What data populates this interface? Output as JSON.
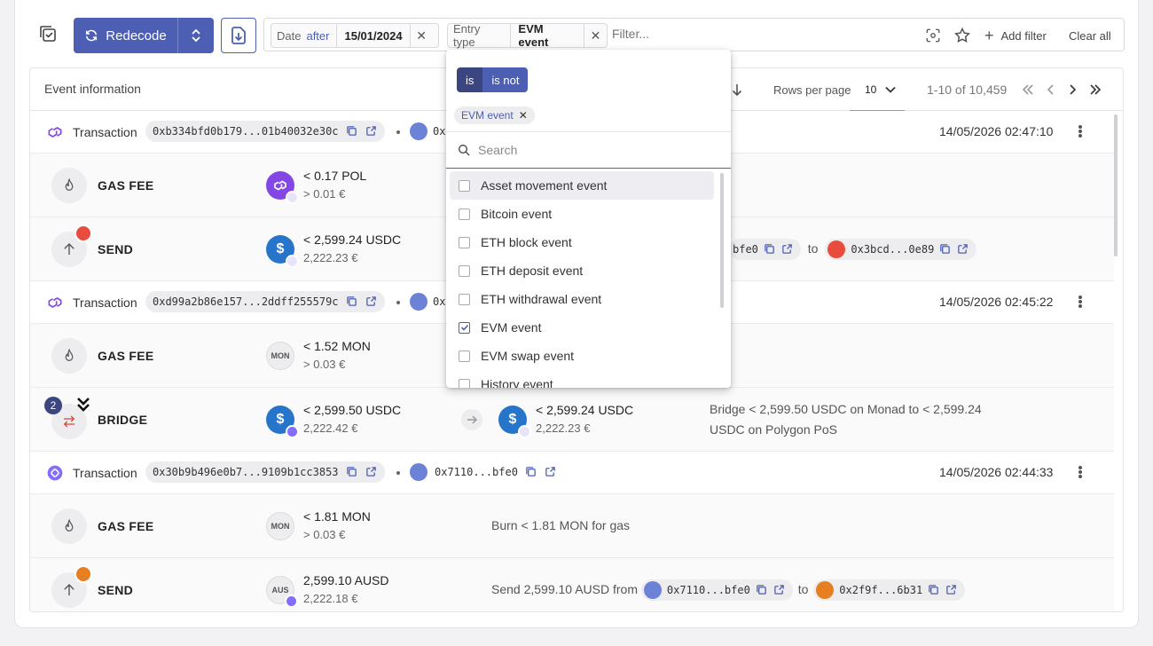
{
  "toolbar": {
    "redecode_label": "Redecode"
  },
  "filters": {
    "date_key": "Date",
    "date_op": "after",
    "date_value": "15/01/2024",
    "entry_key": "Entry type",
    "entry_value": "EVM event",
    "placeholder": "Filter...",
    "add_filter": "Add filter",
    "clear_all": "Clear all"
  },
  "table": {
    "header": "Event information",
    "rows_per_page_label": "Rows per page",
    "rows_per_page": "10",
    "range": "1-10 of 10,459"
  },
  "transactions": [
    {
      "label": "Transaction",
      "hash": "0xb334bfd0b179...01b40032e30c",
      "addr": "0x",
      "time": "14/05/2026 02:47:10"
    },
    {
      "label": "Transaction",
      "hash": "0xd99a2b86e157...2ddff255579c",
      "addr": "0x",
      "time": "14/05/2026 02:45:22"
    },
    {
      "label": "Transaction",
      "hash": "0x30b9b496e0b7...9109b1cc3853",
      "addr": "0x7110...bfe0",
      "time": "14/05/2026 02:44:33"
    }
  ],
  "events": [
    {
      "type": "GAS FEE",
      "amount": "< 0.17 POL",
      "fiat": "> 0.01 €"
    },
    {
      "type": "SEND",
      "amount": "< 2,599.24 USDC",
      "fiat": "2,222.23 €",
      "from_partial": "bfe0",
      "to_word": "to",
      "to_addr": "0x3bcd...0e89"
    },
    {
      "type": "GAS FEE",
      "amount": "< 1.52 MON",
      "fiat": "> 0.03 €",
      "coin": "MON"
    },
    {
      "type": "BRIDGE",
      "count": "2",
      "amount": "< 2,599.50 USDC",
      "fiat": "2,222.42 €",
      "amount2": "< 2,599.24 USDC",
      "fiat2": "2,222.23 €",
      "note_line1": "Bridge < 2,599.50 USDC on Monad to < 2,599.24",
      "note_line2": "USDC on Polygon PoS"
    },
    {
      "type": "GAS FEE",
      "amount": "< 1.81 MON",
      "fiat": "> 0.03 €",
      "coin": "MON",
      "note": "Burn < 1.81 MON for gas"
    },
    {
      "type": "SEND",
      "amount": "2,599.10 AUSD",
      "fiat": "2,222.18 €",
      "coin": "AUS",
      "note_prefix": "Send 2,599.10 AUSD from",
      "from_addr": "0x7110...bfe0",
      "to_word": "to",
      "to_addr": "0x2f9f...6b31"
    }
  ],
  "dropdown": {
    "is": "is",
    "is_not": "is not",
    "selected_chip": "EVM event",
    "search_placeholder": "Search",
    "options": [
      {
        "label": "Asset movement event",
        "checked": false
      },
      {
        "label": "Bitcoin event",
        "checked": false
      },
      {
        "label": "ETH block event",
        "checked": false
      },
      {
        "label": "ETH deposit event",
        "checked": false
      },
      {
        "label": "ETH withdrawal event",
        "checked": false
      },
      {
        "label": "EVM event",
        "checked": true
      },
      {
        "label": "EVM swap event",
        "checked": false
      },
      {
        "label": "History event",
        "checked": false
      }
    ]
  },
  "colors": {
    "accent": "#4c5fb2",
    "dark_toggle": "#3b4580",
    "polygon": "#8247e5",
    "usdc": "#2775ca",
    "monad": "#836ef9"
  }
}
